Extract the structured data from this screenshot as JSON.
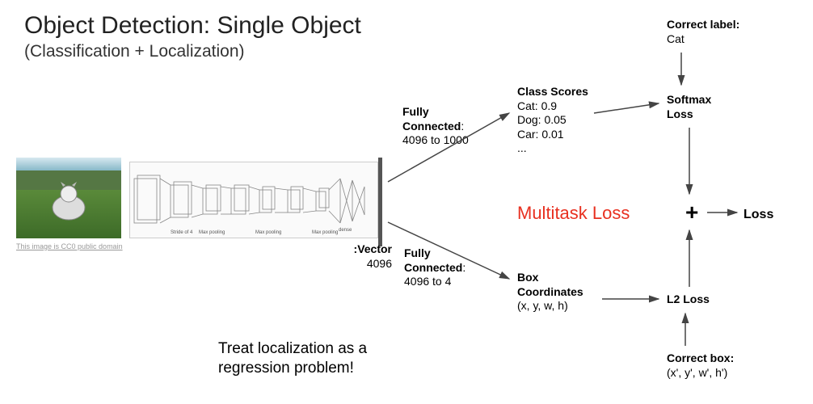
{
  "title": "Object Detection: Single Object",
  "subtitle": "(Classification + Localization)",
  "attribution_text": "This image",
  "attribution_text2": " is ",
  "attribution_license": "CC0 public domain",
  "vector_label_bold": "Vector:",
  "vector_label_value": "4096",
  "fc1_bold": "Fully Connected",
  "fc1_rest": ": 4096 to 1000",
  "fc2_bold": "Fully Connected",
  "fc2_rest": ": 4096 to 4",
  "class_scores_header": "Class Scores",
  "class_scores": {
    "line1": "Cat: 0.9",
    "line2": "Dog: 0.05",
    "line3": "Car: 0.01",
    "line4": "..."
  },
  "box_coords_header1": "Box",
  "box_coords_header2": "Coordinates",
  "box_coords_value": "(x, y, w, h)",
  "correct_label_header": "Correct label:",
  "correct_label_value": "Cat",
  "softmax_loss1": "Softmax",
  "softmax_loss2": "Loss",
  "l2_loss": "L2 Loss",
  "correct_box_header": "Correct box:",
  "correct_box_value": "(x', y', w', h')",
  "multitask": "Multitask Loss",
  "loss_text": "Loss",
  "plus": "+",
  "note1": "Treat localization as a",
  "note2": "regression problem!"
}
